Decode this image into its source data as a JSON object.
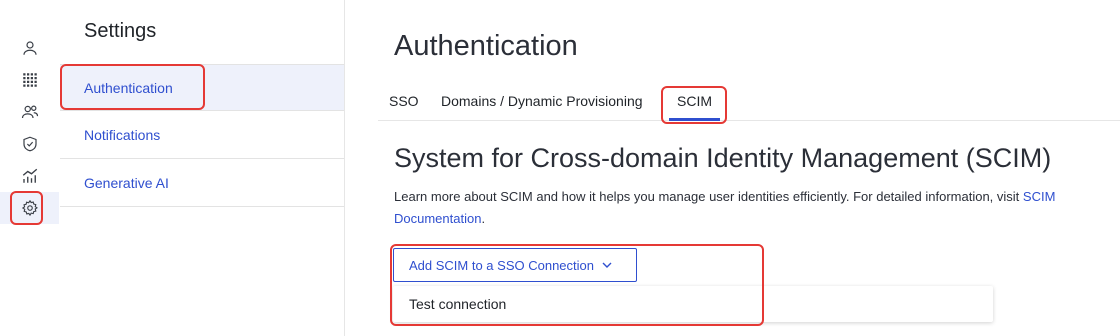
{
  "rail": {
    "items": [
      {
        "icon": "user-icon",
        "active": false
      },
      {
        "icon": "apps-grid-icon",
        "active": false
      },
      {
        "icon": "users-icon",
        "active": false
      },
      {
        "icon": "shield-icon",
        "active": false
      },
      {
        "icon": "analytics-icon",
        "active": false
      },
      {
        "icon": "gear-icon",
        "active": true
      }
    ]
  },
  "settings": {
    "title": "Settings",
    "menu": [
      {
        "label": "Authentication",
        "active": true
      },
      {
        "label": "Notifications",
        "active": false
      },
      {
        "label": "Generative AI",
        "active": false
      }
    ]
  },
  "main": {
    "title": "Authentication",
    "tabs": [
      {
        "label": "SSO",
        "active": false
      },
      {
        "label": "Domains / Dynamic Provisioning",
        "active": false
      },
      {
        "label": "SCIM",
        "active": true
      }
    ],
    "section_title": "System for Cross-domain Identity Management (SCIM)",
    "description_text": "Learn more about SCIM and how it helps you manage user identities efficiently. For detailed information, visit ",
    "description_link": "SCIM Documentation",
    "description_end": ".",
    "add_button_label": "Add SCIM to a SSO Connection",
    "dropdown_items": [
      "Test connection"
    ]
  },
  "colors": {
    "accent": "#2f4fcf",
    "highlight": "#e53935",
    "active_bg": "#eef1fb"
  }
}
